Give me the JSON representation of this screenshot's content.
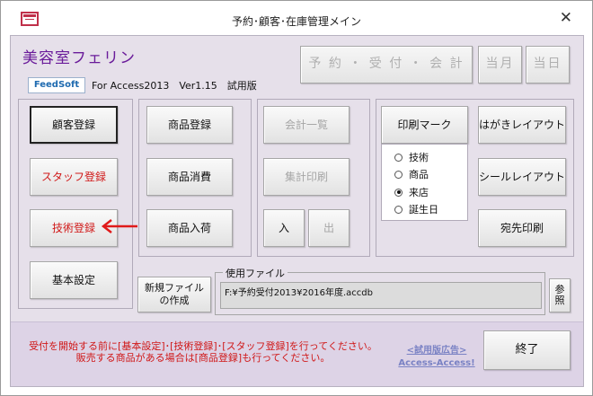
{
  "window": {
    "title": "予約･顧客･在庫管理メイン",
    "close_glyph": "✕"
  },
  "header": {
    "salon_name": "美容室フェリン",
    "feedsoft_logo": "FeedSoft",
    "version": "For Access2013　Ver1.15　試用版"
  },
  "top_buttons": {
    "reservation": "予 約 ・ 受 付 ・ 会 計",
    "this_month": "当月",
    "today": "当日"
  },
  "left_panel": {
    "customer_register": "顧客登録",
    "staff_register": "スタッフ登録",
    "technique_register": "技術登録",
    "basic_settings": "基本設定"
  },
  "product_panel": {
    "product_register": "商品登録",
    "product_consume": "商品消費",
    "product_arrival": "商品入荷"
  },
  "accounting_panel": {
    "accounting_list": "会計一覧",
    "summary_print": "集計印刷",
    "in": "入",
    "out": "出"
  },
  "print_panel": {
    "print_mark": "印刷マーク",
    "postcard_layout": "はがきレイアウト",
    "sticker_layout": "シールレイアウト",
    "address_print": "宛先印刷",
    "options": [
      "技術",
      "商品",
      "来店",
      "誕生日"
    ],
    "selected": "来店"
  },
  "file": {
    "new_file_button": "新規ファイルの作成",
    "legend": "使用ファイル",
    "path": "F:¥予約受付2013¥2016年度.accdb",
    "browse_button": "参照"
  },
  "footer": {
    "notice_line1": "受付を開始する前に[基本設定]･[技術登録]･[スタッフ登録]を行ってください。",
    "notice_line2": "販売する商品がある場合は[商品登録]も行ってください。",
    "trial_ad": "<試用版広告>",
    "trial_ad_sub": "Access-Access!",
    "exit_button": "終了"
  },
  "colors": {
    "form_background": "#e6e0ea",
    "band_background": "#ddd3e6",
    "accent_red": "#d01818",
    "salon_purple": "#6a1b9a",
    "feedsoft_blue": "#1e6ab0"
  }
}
